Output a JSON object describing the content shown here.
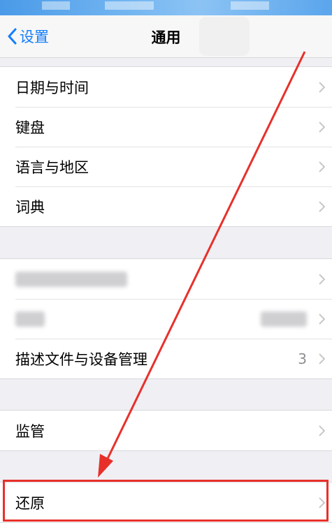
{
  "navbar": {
    "back_label": "设置",
    "title": "通用"
  },
  "groups": [
    {
      "rows": [
        {
          "label": "日期与时间"
        },
        {
          "label": "键盘"
        },
        {
          "label": "语言与地区"
        },
        {
          "label": "词典"
        }
      ]
    },
    {
      "rows": [
        {
          "label": ""
        },
        {
          "label": ""
        },
        {
          "label": "描述文件与设备管理",
          "value": "3"
        }
      ]
    },
    {
      "rows": [
        {
          "label": "监管"
        }
      ]
    },
    {
      "rows": [
        {
          "label": "还原"
        }
      ]
    }
  ],
  "annotation": {
    "color": "#e8302a"
  },
  "colors": {
    "accent": "#147efb",
    "chevron": "#c7c7cc"
  }
}
